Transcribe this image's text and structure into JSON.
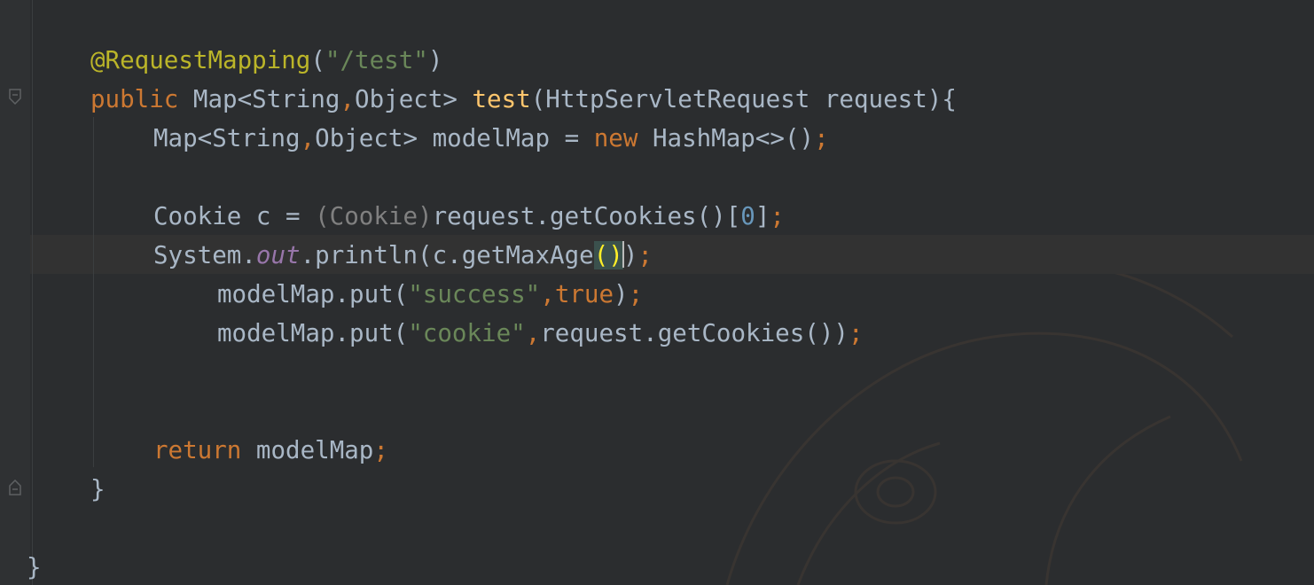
{
  "editor": {
    "lines": [
      {
        "id": "l1",
        "tokens": [
          {
            "t": "@RequestMapping",
            "c": "ann"
          },
          {
            "t": "(",
            "c": "plain"
          },
          {
            "t": "\"/test\"",
            "c": "str"
          },
          {
            "t": ")",
            "c": "plain"
          }
        ]
      },
      {
        "id": "l2",
        "tokens": [
          {
            "t": "public ",
            "c": "kw"
          },
          {
            "t": "Map<String",
            "c": "plain"
          },
          {
            "t": ",",
            "c": "kw"
          },
          {
            "t": "Object> ",
            "c": "plain"
          },
          {
            "t": "test",
            "c": "fn"
          },
          {
            "t": "(HttpServletRequest request){",
            "c": "plain"
          }
        ]
      },
      {
        "id": "l3",
        "tokens": [
          {
            "t": "Map<String",
            "c": "plain"
          },
          {
            "t": ",",
            "c": "kw"
          },
          {
            "t": "Object> modelMap = ",
            "c": "plain"
          },
          {
            "t": "new ",
            "c": "kw"
          },
          {
            "t": "HashMap<>()",
            "c": "plain"
          },
          {
            "t": ";",
            "c": "kw"
          }
        ]
      },
      {
        "id": "l4",
        "tokens": []
      },
      {
        "id": "l5",
        "tokens": [
          {
            "t": "Cookie c = ",
            "c": "plain"
          },
          {
            "t": "(Cookie)",
            "c": "dim"
          },
          {
            "t": "request.getCookies()[",
            "c": "plain"
          },
          {
            "t": "0",
            "c": "num"
          },
          {
            "t": "]",
            "c": "plain"
          },
          {
            "t": ";",
            "c": "kw"
          }
        ]
      },
      {
        "id": "l6",
        "tokens": [
          {
            "t": "System.",
            "c": "plain"
          },
          {
            "t": "out",
            "c": "static"
          },
          {
            "t": ".println(c.getMaxAge",
            "c": "plain"
          },
          {
            "t": "()",
            "c": "brace-hl"
          },
          {
            "t": ")",
            "c": "plain"
          },
          {
            "t": ";",
            "c": "kw"
          }
        ]
      },
      {
        "id": "l7",
        "tokens": [
          {
            "t": "modelMap.put(",
            "c": "plain"
          },
          {
            "t": "\"success\"",
            "c": "str"
          },
          {
            "t": ",",
            "c": "kw"
          },
          {
            "t": "true",
            "c": "kw"
          },
          {
            "t": ")",
            "c": "plain"
          },
          {
            "t": ";",
            "c": "kw"
          }
        ]
      },
      {
        "id": "l8",
        "tokens": [
          {
            "t": "modelMap.put(",
            "c": "plain"
          },
          {
            "t": "\"cookie\"",
            "c": "str"
          },
          {
            "t": ",",
            "c": "kw"
          },
          {
            "t": "request.getCookies())",
            "c": "plain"
          },
          {
            "t": ";",
            "c": "kw"
          }
        ]
      },
      {
        "id": "l9",
        "tokens": []
      },
      {
        "id": "l10",
        "tokens": []
      },
      {
        "id": "l11",
        "tokens": [
          {
            "t": "return ",
            "c": "kw"
          },
          {
            "t": "modelMap",
            "c": "plain"
          },
          {
            "t": ";",
            "c": "kw"
          }
        ]
      },
      {
        "id": "l12",
        "tokens": [
          {
            "t": "}",
            "c": "plain"
          }
        ]
      },
      {
        "id": "l13",
        "tokens": []
      },
      {
        "id": "l14",
        "tokens": [
          {
            "t": "}",
            "c": "plain"
          }
        ]
      }
    ]
  },
  "colors": {
    "background": "#2b2d2f",
    "annotation": "#bbb529",
    "keyword": "#cc7832",
    "string": "#6a8759",
    "number": "#6897bb",
    "method_decl": "#ffc66d",
    "static_field": "#9876aa",
    "default_text": "#a9b7c6"
  }
}
